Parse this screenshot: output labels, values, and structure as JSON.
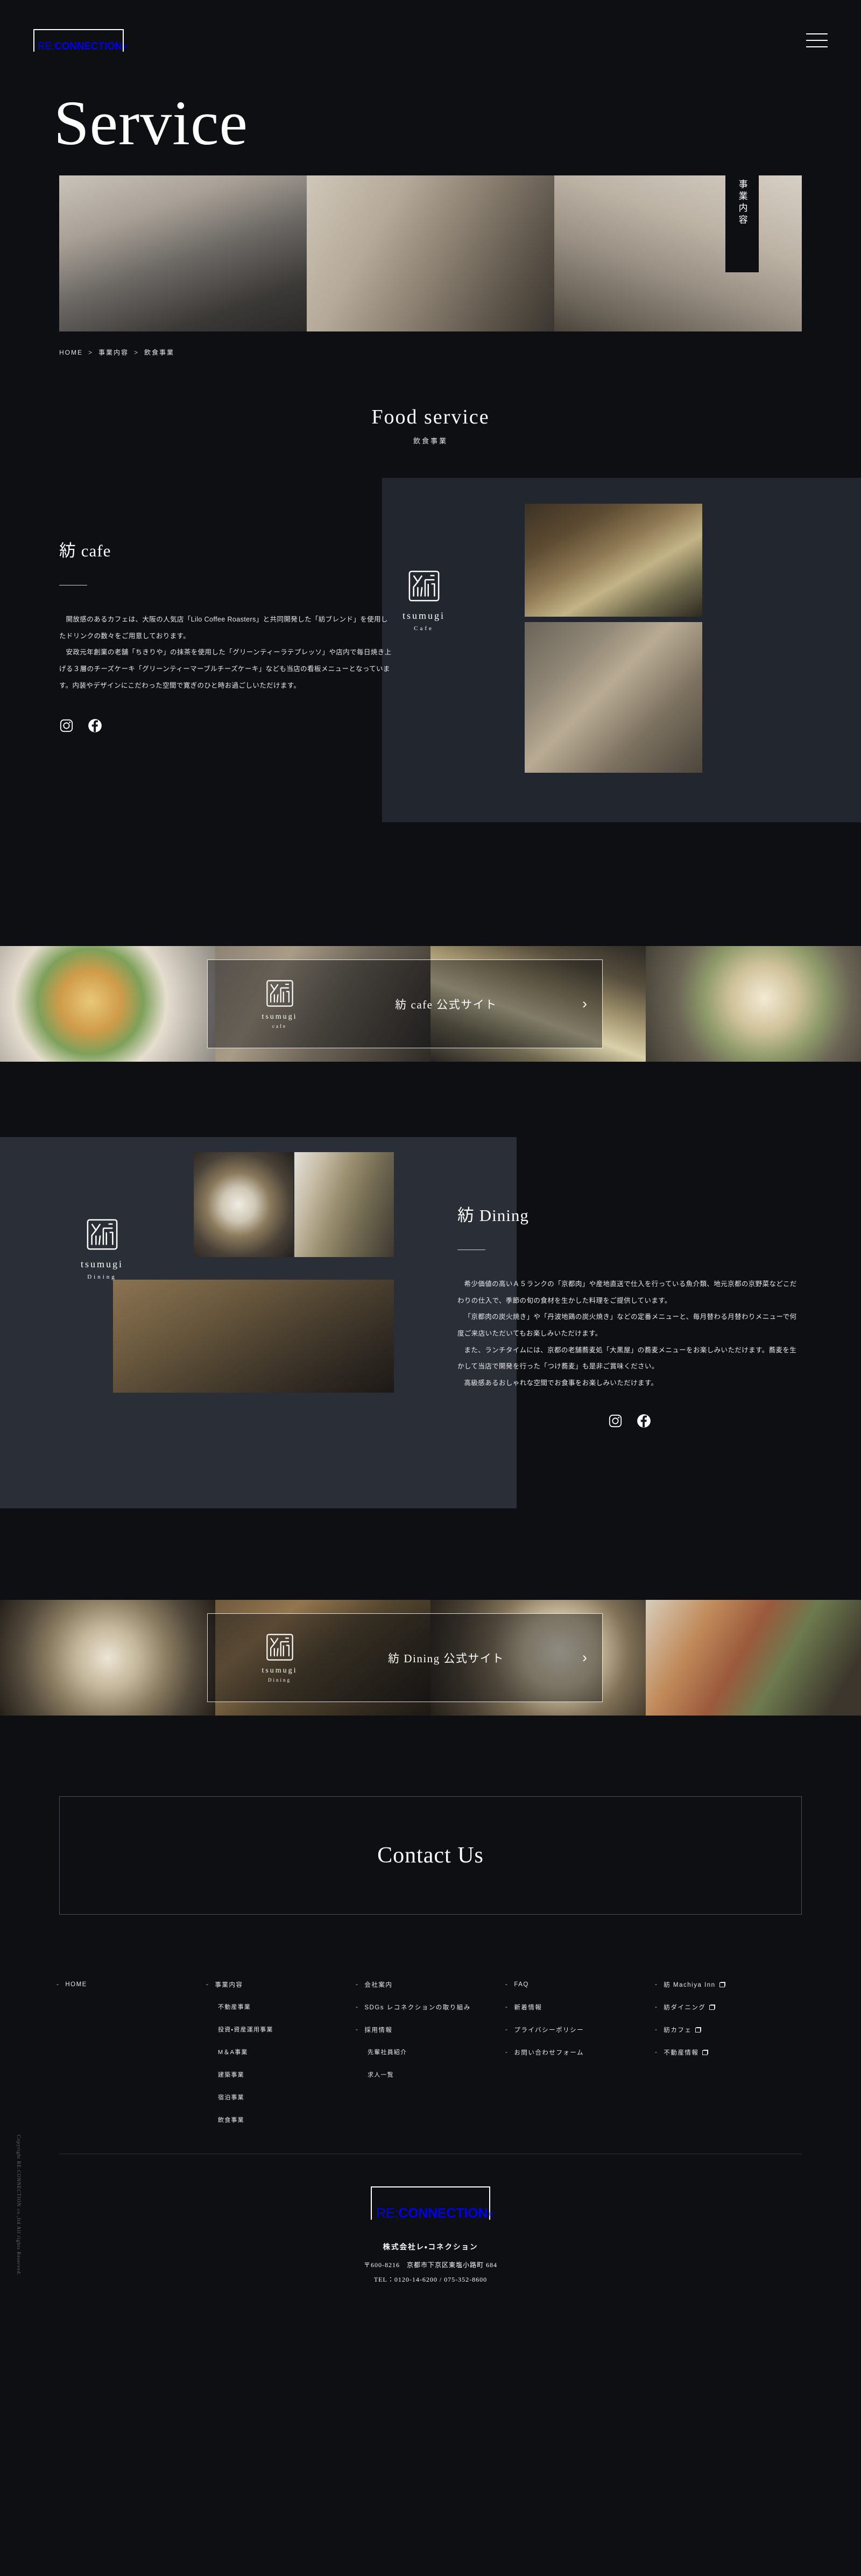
{
  "header": {
    "logo_prefix": "RE:",
    "logo_main": "CONNECTION",
    "logo_reg": "®",
    "menu_icon": "hamburger-icon"
  },
  "hero": {
    "title": "Service",
    "vertical_label": "事業内容",
    "breadcrumb": [
      "HOME",
      "事業内容",
      "飲食事業"
    ],
    "breadcrumb_sep": ">"
  },
  "section": {
    "title_en": "Food service",
    "title_jp": "飲食事業"
  },
  "cafe": {
    "heading": "紡 cafe",
    "paragraphs": [
      "開放感のあるカフェは、大阪の人気店「Lilo Coffee Roasters」と共同開発した「紡ブレンド」を使用したドリンクの数々をご用意しております。",
      "安政元年創業の老舗「ちきりや」の抹茶を使用した「グリーンティーラテプレッソ」や店内で毎日焼き上げる３層のチーズケーキ「グリーンティーマーブルチーズケーキ」なども当店の看板メニューとなっています。内装やデザインにこだわった空間で寛ぎのひと時お過ごしいただけます。"
    ],
    "social": [
      {
        "name": "instagram-icon",
        "label": "Instagram"
      },
      {
        "name": "facebook-icon",
        "label": "Facebook"
      }
    ],
    "brand_name": "tsumugi",
    "brand_sub": "Cafe",
    "cta_label": "紡 cafe 公式サイト",
    "cta_arrow": "›",
    "cta_brand_name": "tsumugi",
    "cta_brand_sub": "cafe"
  },
  "dining": {
    "heading": "紡 Dining",
    "paragraphs": [
      "希少価値の高いＡ５ランクの「京都肉」や産地直送で仕入を行っている魚介類、地元京都の京野菜などこだわりの仕入で、季節の旬の食材を生かした料理をご提供しています。",
      "「京都肉の炭火焼き」や「丹波地鶏の炭火焼き」などの定番メニューと、毎月替わる月替わりメニューで何度ご来店いただいてもお楽しみいただけます。",
      "また、ランチタイムには、京都の老舗蕎麦処「大黒屋」の蕎麦メニューをお楽しみいただけます。蕎麦を生かして当店で開発を行った「つけ蕎麦」も是非ご賞味ください。",
      "高級感あるおしゃれな空間でお食事をお楽しみいただけます。"
    ],
    "social": [
      {
        "name": "instagram-icon",
        "label": "Instagram"
      },
      {
        "name": "facebook-icon",
        "label": "Facebook"
      }
    ],
    "brand_name": "tsumugi",
    "brand_sub": "Dining",
    "cta_label": "紡 Dining 公式サイト",
    "cta_arrow": "›",
    "cta_brand_name": "tsumugi",
    "cta_brand_sub": "Dining"
  },
  "contact": {
    "title": "Contact Us"
  },
  "footer": {
    "columns": [
      {
        "items": [
          {
            "label": "HOME",
            "dash": true,
            "sub": false,
            "external": false
          }
        ]
      },
      {
        "items": [
          {
            "label": "事業内容",
            "dash": true,
            "sub": false,
            "external": false
          },
          {
            "label": "不動産事業",
            "dash": false,
            "sub": true,
            "external": false
          },
          {
            "label": "投資・資産運用事業",
            "dash": false,
            "sub": true,
            "external": false
          },
          {
            "label": "M＆A事業",
            "dash": false,
            "sub": true,
            "external": false
          },
          {
            "label": "建築事業",
            "dash": false,
            "sub": true,
            "external": false
          },
          {
            "label": "宿泊事業",
            "dash": false,
            "sub": true,
            "external": false
          },
          {
            "label": "飲食事業",
            "dash": false,
            "sub": true,
            "external": false
          }
        ]
      },
      {
        "items": [
          {
            "label": "会社案内",
            "dash": true,
            "sub": false,
            "external": false
          },
          {
            "label": "SDGs レコネクションの取り組み",
            "dash": true,
            "sub": false,
            "external": false
          },
          {
            "label": "採用情報",
            "dash": true,
            "sub": false,
            "external": false
          },
          {
            "label": "先輩社員紹介",
            "dash": false,
            "sub": true,
            "external": false
          },
          {
            "label": "求人一覧",
            "dash": false,
            "sub": true,
            "external": false
          }
        ]
      },
      {
        "items": [
          {
            "label": "FAQ",
            "dash": true,
            "sub": false,
            "external": false
          },
          {
            "label": "新着情報",
            "dash": true,
            "sub": false,
            "external": false
          },
          {
            "label": "プライバシーポリシー",
            "dash": true,
            "sub": false,
            "external": false
          },
          {
            "label": "お問い合わせフォーム",
            "dash": true,
            "sub": false,
            "external": false
          }
        ]
      },
      {
        "items": [
          {
            "label": "紡 Machiya Inn",
            "dash": true,
            "sub": false,
            "external": true
          },
          {
            "label": "紡ダイニング",
            "dash": true,
            "sub": false,
            "external": true
          },
          {
            "label": "紡カフェ",
            "dash": true,
            "sub": false,
            "external": true
          },
          {
            "label": "不動産情報",
            "dash": true,
            "sub": false,
            "external": true
          }
        ]
      }
    ],
    "company": "株式会社レ・コネクション",
    "address": "〒600-8216　京都市下京区東塩小路町 684",
    "tel": "TEL：0120-14-6200 / 075-352-8600",
    "copyright": "Copyright RE:CONNECTION co.,ltd All rights Reserved."
  }
}
